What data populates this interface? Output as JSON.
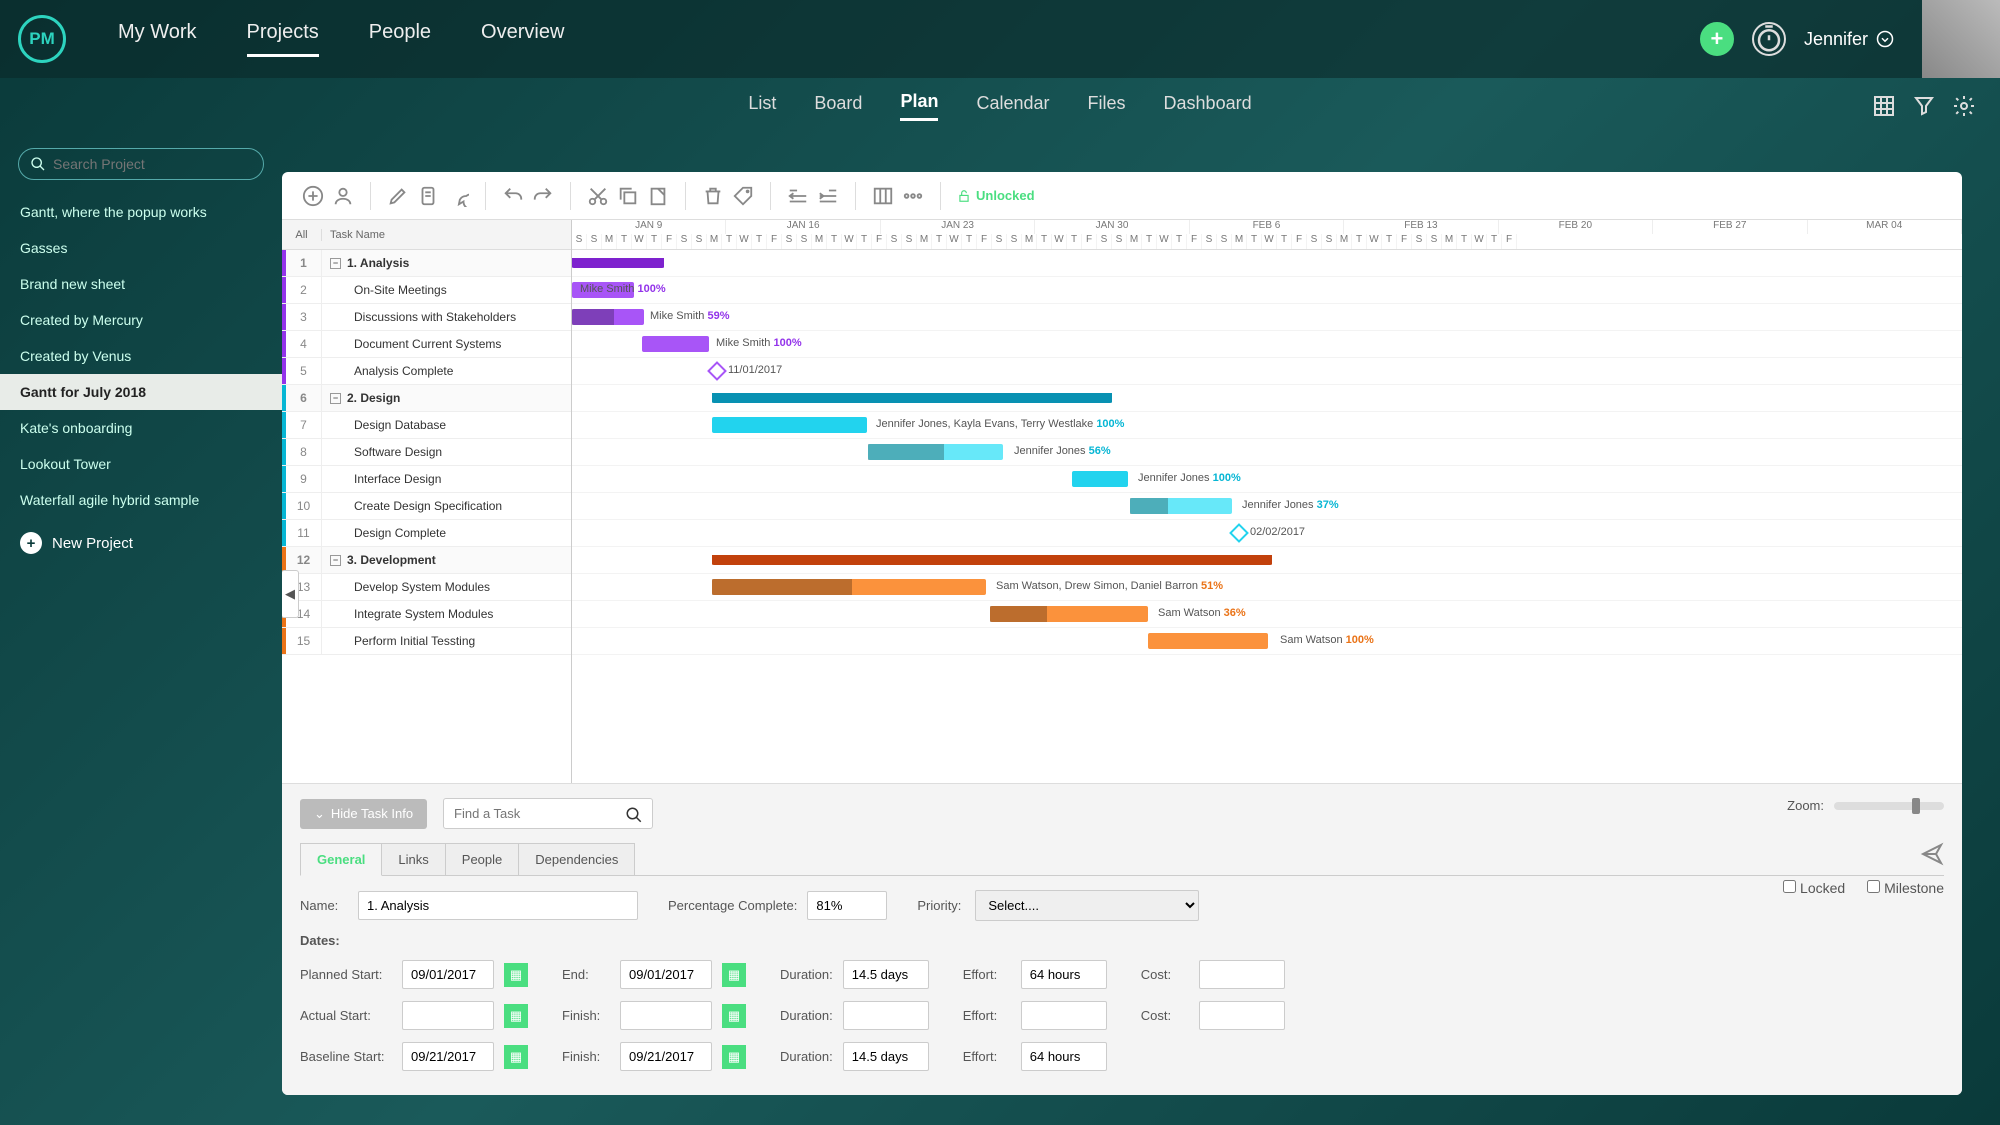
{
  "logo": "PM",
  "nav": {
    "mywork": "My Work",
    "projects": "Projects",
    "people": "People",
    "overview": "Overview"
  },
  "user": {
    "name": "Jennifer"
  },
  "subnav": {
    "list": "List",
    "board": "Board",
    "plan": "Plan",
    "calendar": "Calendar",
    "files": "Files",
    "dashboard": "Dashboard"
  },
  "search": {
    "placeholder": "Search Project"
  },
  "projects": [
    "Gantt, where the popup works",
    "Gasses",
    "Brand new sheet",
    "Created by Mercury",
    "Created by Venus",
    "Gantt for July 2018",
    "Kate's onboarding",
    "Lookout Tower",
    "Waterfall agile hybrid sample"
  ],
  "newproject": "New Project",
  "unlocked": "Unlocked",
  "tlhead": {
    "all": "All",
    "taskname": "Task Name"
  },
  "timeline": {
    "months": [
      "JAN 9",
      "JAN 16",
      "JAN 23",
      "JAN 30",
      "FEB 6",
      "FEB 13",
      "FEB 20",
      "FEB 27",
      "MAR 04"
    ],
    "daypattern": "SSMTWTFSSMTWTF"
  },
  "tasks": [
    {
      "n": 1,
      "name": "1. Analysis",
      "phase": true,
      "c": "purple"
    },
    {
      "n": 2,
      "name": "On-Site Meetings",
      "c": "purple",
      "label": "Mike Smith",
      "pct": "100%"
    },
    {
      "n": 3,
      "name": "Discussions with Stakeholders",
      "c": "purple",
      "label": "Mike Smith",
      "pct": "59%"
    },
    {
      "n": 4,
      "name": "Document Current Systems",
      "c": "purple",
      "label": "Mike Smith",
      "pct": "100%"
    },
    {
      "n": 5,
      "name": "Analysis Complete",
      "c": "purple",
      "milestone": true,
      "date": "11/01/2017"
    },
    {
      "n": 6,
      "name": "2. Design",
      "phase": true,
      "c": "blue"
    },
    {
      "n": 7,
      "name": "Design Database",
      "c": "blue",
      "label": "Jennifer Jones, Kayla Evans, Terry Westlake",
      "pct": "100%"
    },
    {
      "n": 8,
      "name": "Software Design",
      "c": "blue",
      "label": "Jennifer Jones",
      "pct": "56%"
    },
    {
      "n": 9,
      "name": "Interface Design",
      "c": "blue",
      "label": "Jennifer Jones",
      "pct": "100%"
    },
    {
      "n": 10,
      "name": "Create Design Specification",
      "c": "blue",
      "label": "Jennifer Jones",
      "pct": "37%"
    },
    {
      "n": 11,
      "name": "Design Complete",
      "c": "blue",
      "milestone": true,
      "date": "02/02/2017"
    },
    {
      "n": 12,
      "name": "3. Development",
      "phase": true,
      "c": "orange"
    },
    {
      "n": 13,
      "name": "Develop System Modules",
      "c": "orange",
      "label": "Sam Watson, Drew Simon, Daniel Barron",
      "pct": "51%"
    },
    {
      "n": 14,
      "name": "Integrate System Modules",
      "c": "orange",
      "label": "Sam Watson",
      "pct": "36%"
    },
    {
      "n": 15,
      "name": "Perform Initial Tessting",
      "c": "orange",
      "label": "Sam Watson",
      "pct": "100%"
    }
  ],
  "bottom": {
    "hide": "Hide Task Info",
    "find": "Find a Task",
    "zoom": "Zoom:",
    "tabs": {
      "general": "General",
      "links": "Links",
      "people": "People",
      "deps": "Dependencies"
    },
    "labels": {
      "name": "Name:",
      "pct": "Percentage Complete:",
      "priority": "Priority:",
      "locked": "Locked",
      "milestone": "Milestone",
      "dates": "Dates:",
      "pstart": "Planned Start:",
      "end": "End:",
      "dur": "Duration:",
      "effort": "Effort:",
      "cost": "Cost:",
      "astart": "Actual Start:",
      "finish": "Finish:",
      "bstart": "Baseline Start:"
    },
    "vals": {
      "name": "1. Analysis",
      "pct": "81%",
      "priority": "Select....",
      "pstart": "09/01/2017",
      "end": "09/01/2017",
      "dur": "14.5 days",
      "effort": "64 hours",
      "bstart": "09/21/2017",
      "bfinish": "09/21/2017",
      "bdur": "14.5 days",
      "beffort": "64 hours"
    }
  }
}
